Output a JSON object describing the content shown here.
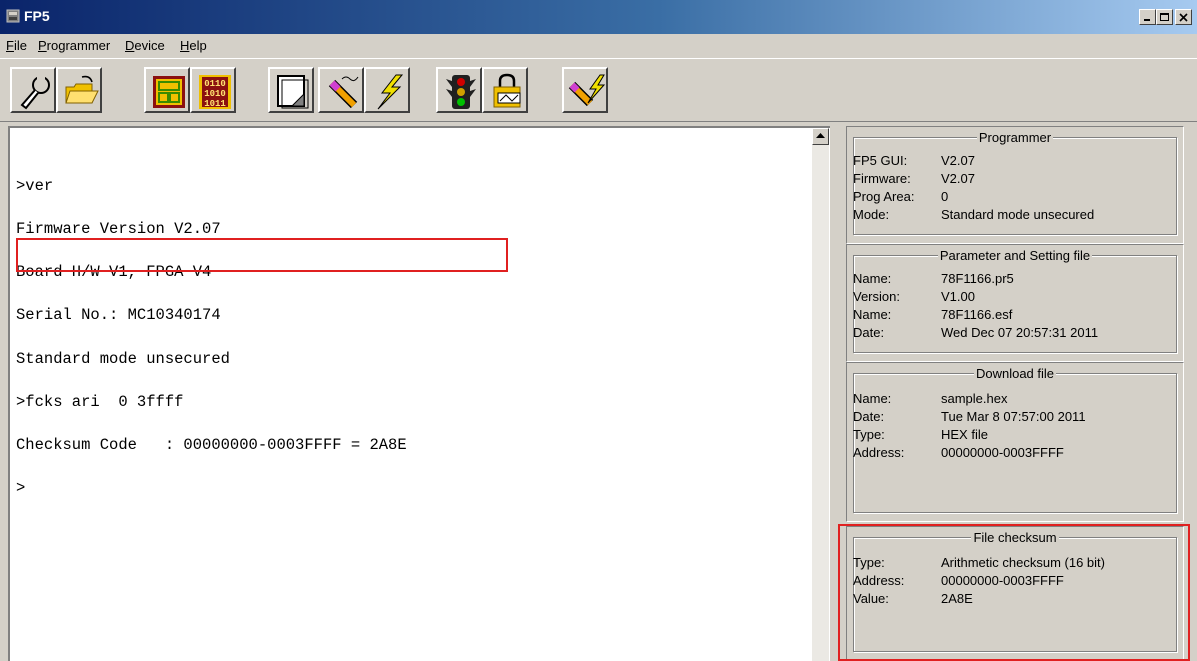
{
  "window": {
    "title": "FP5"
  },
  "menu": [
    {
      "label": "File",
      "mnemonic": "F",
      "rest": "ile"
    },
    {
      "label": "Programmer",
      "mnemonic": "P",
      "rest": "rogrammer"
    },
    {
      "label": "Device",
      "mnemonic": "D",
      "rest": "evice"
    },
    {
      "label": "Help",
      "mnemonic": "H",
      "rest": "elp"
    }
  ],
  "toolbar": {
    "buttons": [
      {
        "icon": "wrench-icon"
      },
      {
        "icon": "open-folder-icon"
      },
      {
        "icon": "chip-layout-icon"
      },
      {
        "icon": "binary-1010-icon",
        "text": "1010\n1011"
      },
      {
        "icon": "blank-page-icon"
      },
      {
        "icon": "probe-pen-icon"
      },
      {
        "icon": "lightning-icon"
      },
      {
        "icon": "traffic-light-icon"
      },
      {
        "icon": "lock-icon"
      },
      {
        "icon": "probe-lightning-icon"
      }
    ]
  },
  "console": {
    "lines": [
      ">ver",
      "Firmware Version V2.07",
      "Board H/W V1, FPGA V4",
      "Serial No.: MC10340174",
      "Standard mode unsecured",
      ">fcks ari  0 3ffff",
      "Checksum Code   : 00000000-0003FFFF = 2A8E",
      ">"
    ]
  },
  "panel": {
    "programmer": {
      "title": "Programmer",
      "rows": [
        {
          "k": "FP5 GUI:",
          "v": "V2.07"
        },
        {
          "k": "Firmware:",
          "v": "V2.07"
        },
        {
          "k": "Prog Area:",
          "v": "0"
        },
        {
          "k": "Mode:",
          "v": "Standard mode unsecured"
        }
      ]
    },
    "param": {
      "title": "Parameter and Setting file",
      "rows": [
        {
          "k": "Name:",
          "v": "78F1166.pr5"
        },
        {
          "k": "Version:",
          "v": "V1.00"
        },
        {
          "k": "Name:",
          "v": "78F1166.esf"
        },
        {
          "k": "Date:",
          "v": "Wed Dec 07 20:57:31 2011"
        }
      ]
    },
    "download": {
      "title": "Download file",
      "rows": [
        {
          "k": "Name:",
          "v": "sample.hex"
        },
        {
          "k": "Date:",
          "v": "Tue Mar  8 07:57:00 2011"
        },
        {
          "k": "Type:",
          "v": "HEX file"
        },
        {
          "k": "Address:",
          "v": "00000000-0003FFFF"
        }
      ]
    },
    "checksum": {
      "title": "File checksum",
      "rows": [
        {
          "k": "Type:",
          "v": "Arithmetic checksum (16 bit)"
        },
        {
          "k": "Address:",
          "v": "00000000-0003FFFF"
        },
        {
          "k": "Value:",
          "v": "2A8E"
        }
      ]
    }
  },
  "colors": {
    "highlight": "#e02020",
    "titlebar_start": "#0a246a",
    "titlebar_end": "#a6caf0"
  }
}
